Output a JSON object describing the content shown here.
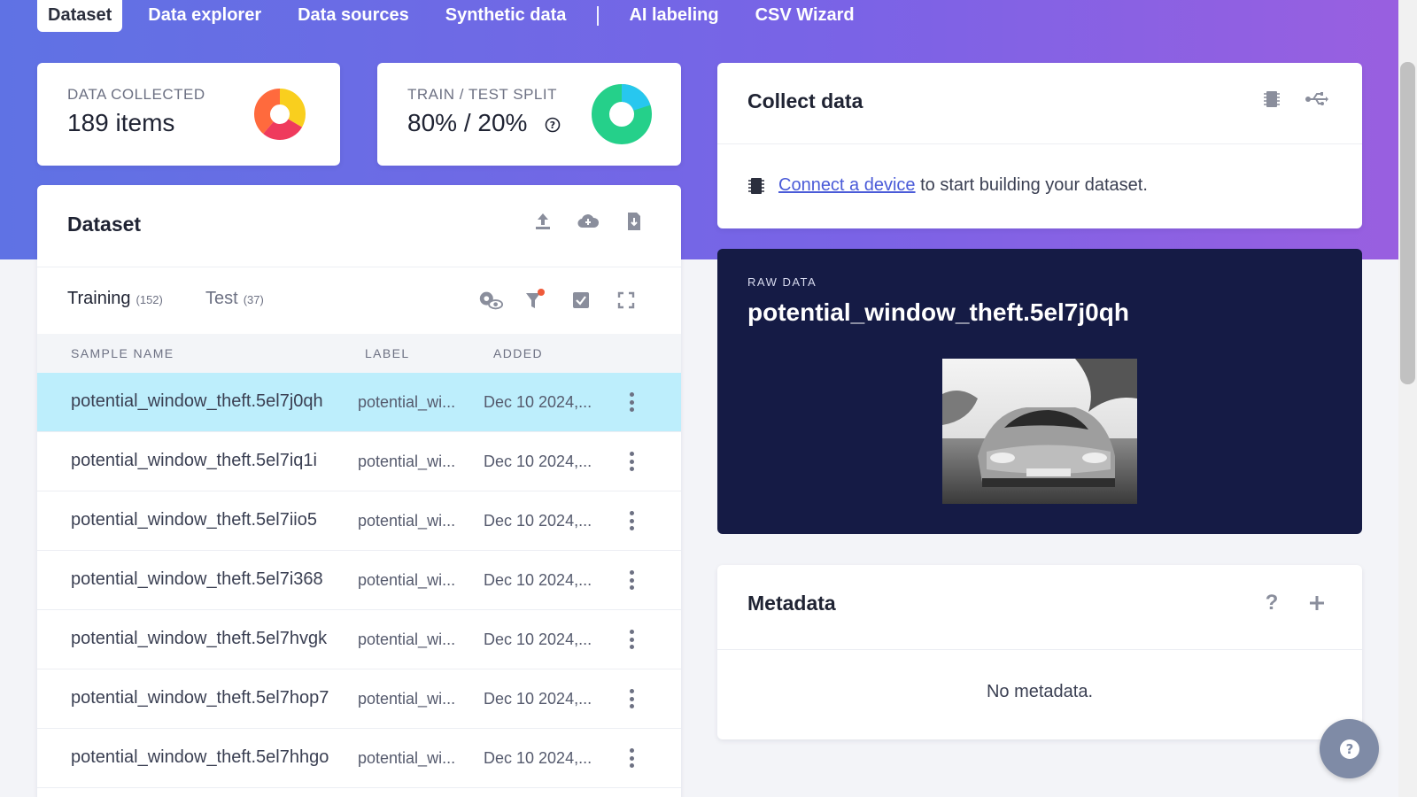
{
  "nav": {
    "tabs": [
      "Dataset",
      "Data explorer",
      "Data sources",
      "Synthetic data"
    ],
    "tabs_after_sep": [
      "AI labeling",
      "CSV Wizard"
    ],
    "active": "Dataset"
  },
  "stats": {
    "collected_label": "DATA COLLECTED",
    "collected_value": "189 items",
    "split_label": "TRAIN / TEST SPLIT",
    "split_value": "80% / 20%",
    "split_train_fraction": 0.8
  },
  "dataset": {
    "title": "Dataset",
    "training_label": "Training",
    "training_count": "(152)",
    "test_label": "Test",
    "test_count": "(37)",
    "columns": [
      "SAMPLE NAME",
      "LABEL",
      "ADDED"
    ],
    "rows": [
      {
        "name": "potential_window_theft.5el7j0qh",
        "label": "potential_wi...",
        "added": "Dec 10 2024,...",
        "selected": true
      },
      {
        "name": "potential_window_theft.5el7iq1i",
        "label": "potential_wi...",
        "added": "Dec 10 2024,...",
        "selected": false
      },
      {
        "name": "potential_window_theft.5el7iio5",
        "label": "potential_wi...",
        "added": "Dec 10 2024,...",
        "selected": false
      },
      {
        "name": "potential_window_theft.5el7i368",
        "label": "potential_wi...",
        "added": "Dec 10 2024,...",
        "selected": false
      },
      {
        "name": "potential_window_theft.5el7hvgk",
        "label": "potential_wi...",
        "added": "Dec 10 2024,...",
        "selected": false
      },
      {
        "name": "potential_window_theft.5el7hop7",
        "label": "potential_wi...",
        "added": "Dec 10 2024,...",
        "selected": false
      },
      {
        "name": "potential_window_theft.5el7hhgo",
        "label": "potential_wi...",
        "added": "Dec 10 2024,...",
        "selected": false
      }
    ]
  },
  "collect": {
    "title": "Collect data",
    "link_text": "Connect a device",
    "rest_text": " to start building your dataset."
  },
  "raw": {
    "label": "RAW DATA",
    "title": "potential_window_theft.5el7j0qh"
  },
  "metadata": {
    "title": "Metadata",
    "empty": "No metadata."
  },
  "colors": {
    "accent": "#6a6be5",
    "selected_row": "#bdeefc",
    "raw_bg": "#151b45"
  }
}
